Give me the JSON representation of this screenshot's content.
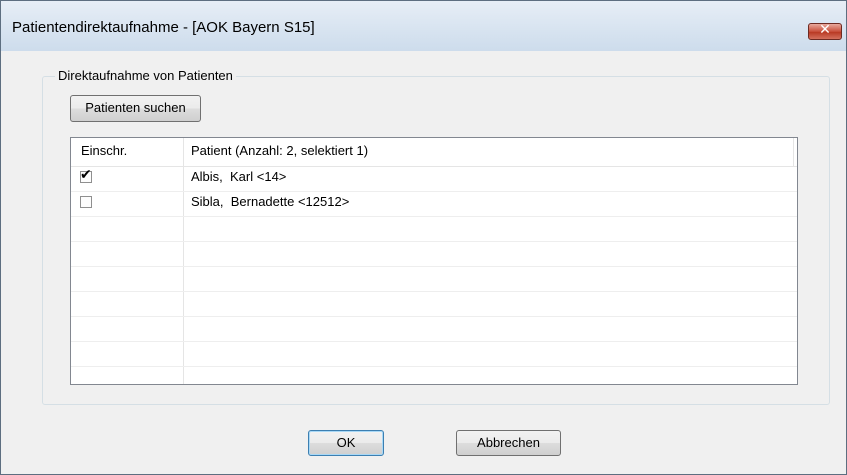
{
  "window": {
    "title": "Patientendirektaufnahme - [AOK Bayern S15]",
    "close_glyph": "✕"
  },
  "group": {
    "label": "Direktaufnahme von Patienten"
  },
  "buttons": {
    "search_label": "Patienten suchen",
    "ok_label": "OK",
    "cancel_label": "Abbrechen"
  },
  "table": {
    "columns": [
      "Einschr.",
      "Patient (Anzahl: 2, selektiert 1)"
    ],
    "rows": [
      {
        "checked": true,
        "check_glyph": "✔",
        "patient": "Albis,  Karl <14>"
      },
      {
        "checked": false,
        "check_glyph": "",
        "patient": "Sibla,  Bernadette <12512>"
      }
    ]
  }
}
